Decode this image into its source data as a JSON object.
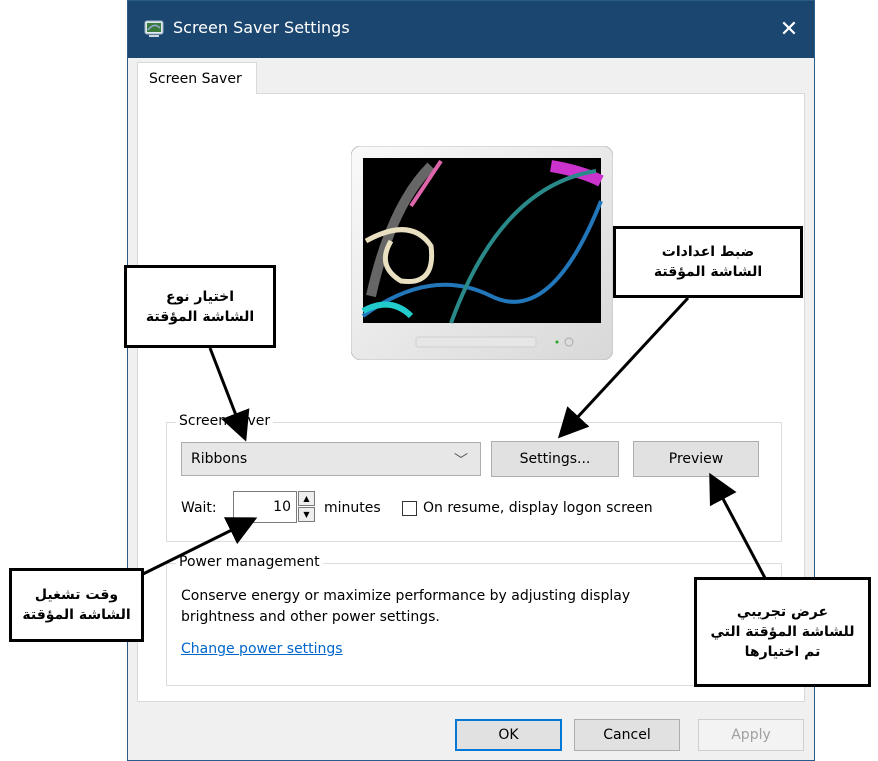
{
  "window": {
    "title": "Screen Saver Settings",
    "close_glyph": "✕",
    "tab_label": "Screen Saver"
  },
  "screensaver": {
    "group_label": "Screen saver",
    "selected": "Ribbons",
    "settings_button": "Settings...",
    "preview_button": "Preview",
    "wait_label": "Wait:",
    "wait_value": "10",
    "minutes_label": "minutes",
    "resume_label": "On resume, display logon screen",
    "resume_checked": false
  },
  "power": {
    "group_label": "Power management",
    "description": "Conserve energy or maximize performance by adjusting display brightness and other power settings.",
    "link": "Change power settings"
  },
  "footer": {
    "ok": "OK",
    "cancel": "Cancel",
    "apply": "Apply"
  },
  "callouts": {
    "choose_type": "اختيار نوع\nالشاشة المؤقتة",
    "adjust_settings": "ضبط اعدادات\nالشاشة المؤقتة",
    "wait_time": "وقت تشغيل\nالشاشة المؤقتة",
    "preview_selected": "عرض تجريبي\nللشاشة المؤقتة التي\nتم اختيارها"
  },
  "colors": {
    "titlebar": "#1b4670",
    "link": "#0066cc",
    "accent": "#0078d7"
  }
}
